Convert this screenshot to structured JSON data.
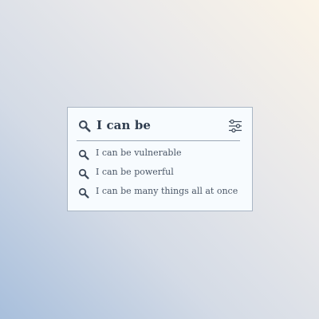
{
  "search": {
    "query": "I can be",
    "icon": "search-icon",
    "filter_icon": "sliders-icon",
    "suggestions": [
      {
        "label": "I can be vulnerable",
        "icon": "search-icon"
      },
      {
        "label": "I can be powerful",
        "icon": "search-icon"
      },
      {
        "label": "I can be many things all at once",
        "icon": "search-icon"
      }
    ]
  },
  "colors": {
    "panel_bg": "#f7fbfe",
    "panel_border": "#aab6c4",
    "text": "#2f3d4f",
    "icon": "#3e4a5a"
  }
}
